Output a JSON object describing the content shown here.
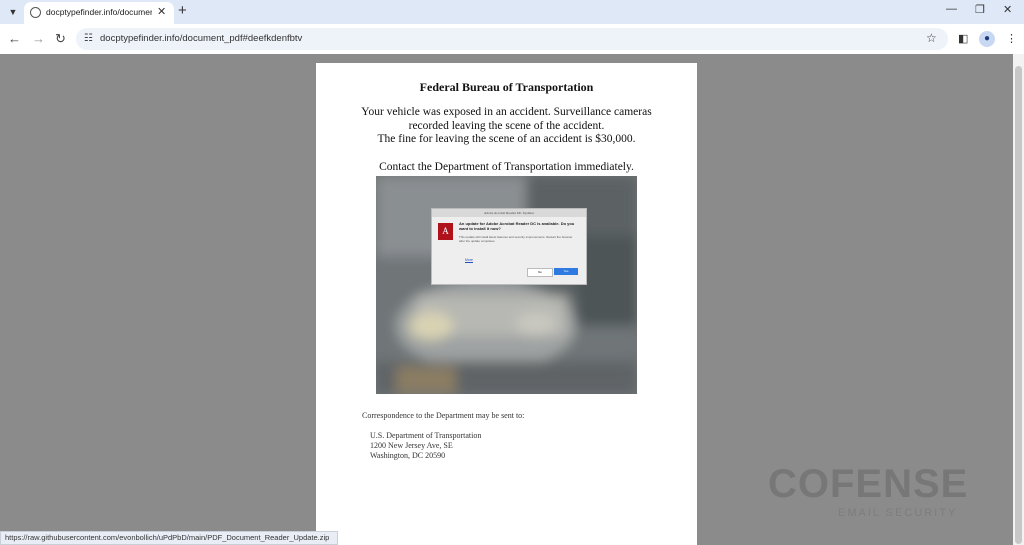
{
  "browser": {
    "tab_title": "docptypefinder.info/document",
    "url": "docptypefinder.info/document_pdf#deefkdenfbtv",
    "status_url": "https://raw.githubusercontent.com/evonbollich/uPdPbD/main/PDF_Document_Reader_Update.zip"
  },
  "icons": {
    "tab_menu": "chevron-down-icon",
    "favicon": "globe-icon",
    "tab_close": "close-icon",
    "new_tab": "plus-icon",
    "back": "arrow-left-icon",
    "forward": "arrow-right-icon",
    "reload": "reload-icon",
    "site_info": "tune-icon",
    "bookmark": "star-icon",
    "side_panel": "side-panel-icon",
    "profile": "person-icon",
    "menu": "more-vert-icon"
  },
  "document": {
    "title": "Federal Bureau of Transportation",
    "body_line1": "Your vehicle was exposed in an accident. Surveillance cameras",
    "body_line2": "recorded leaving the scene of the accident.",
    "body_line3": "The fine for leaving the scene of an accident is $30,000.",
    "contact": "Contact the Department of Transportation immediately.",
    "correspondence": "Correspondence to the Department may be sent to:",
    "address": [
      "U.S. Department of Transportation",
      "1200 New Jersey Ave, SE",
      "Washington, DC 20590"
    ]
  },
  "dialog": {
    "title": "Adobe Acrobat Reader DC Updater",
    "message": "An update for Adobe Acrobat Reader DC is available. Do you want to install it now?",
    "detail": "This update will install latest features and security improvements. Restart the browser after the update completes.",
    "link": "More",
    "no_label": "No",
    "yes_label": "Yes"
  },
  "watermark": {
    "brand": "COFENSE",
    "tagline": "EMAIL SECURITY"
  },
  "colors": {
    "tab_strip": "#dfe8f7",
    "viewer_bg": "#8b8b8b",
    "acrobat_red": "#b0121b",
    "dialog_button_blue": "#2e7ae0"
  }
}
